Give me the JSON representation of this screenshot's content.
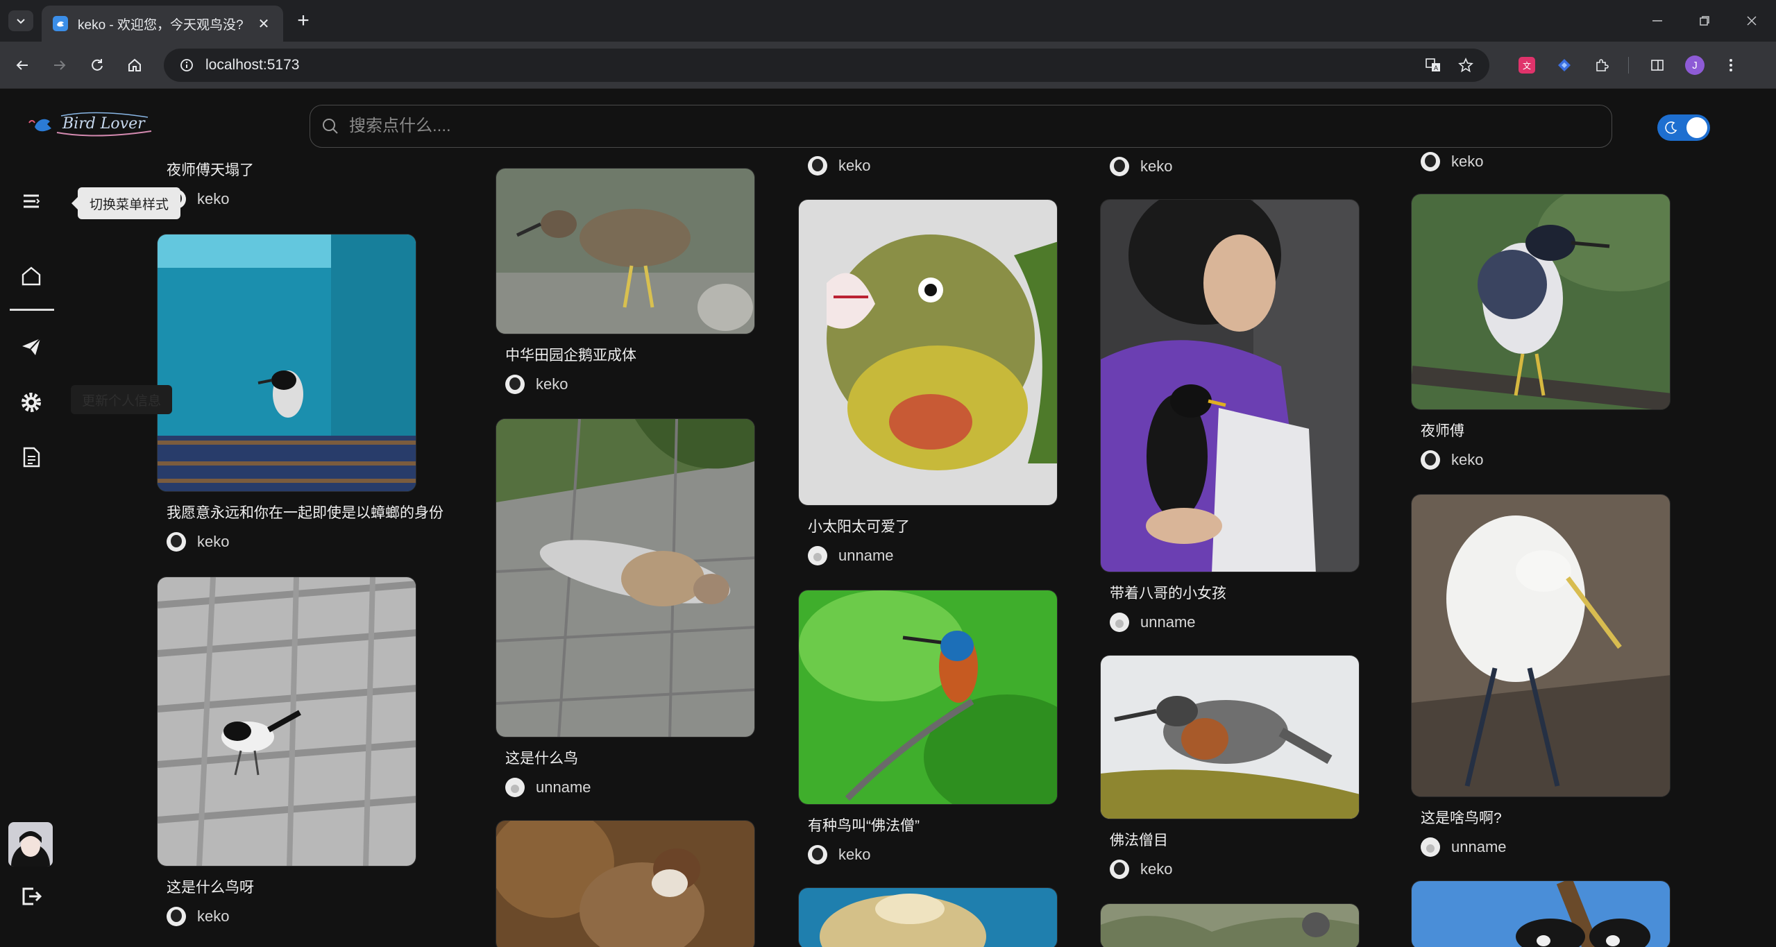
{
  "browser": {
    "tab_title": "keko - 欢迎您，今天观鸟没?",
    "url": "localhost:5173",
    "profile_initial": "J"
  },
  "app": {
    "logo_text": "Bird Lover",
    "search": {
      "placeholder": "搜索点什么...."
    },
    "theme_toggle": "dark"
  },
  "sidebar": {
    "tooltip_menu": "切换菜单样式",
    "tooltip_settings": "更新个人信息",
    "items": [
      "menu-toggle",
      "home",
      "publish",
      "settings",
      "document"
    ]
  },
  "feed": {
    "col1": [
      {
        "title": "夜师傅天塌了",
        "user": "keko"
      },
      {
        "title": "我愿意永远和你在一起即使是以蟑螂的身份",
        "user": "keko"
      },
      {
        "title": "这是什么鸟呀",
        "user": "keko"
      }
    ],
    "col2": [
      {
        "title": "中华田园企鹅亚成体",
        "user": "keko"
      },
      {
        "title": "这是什么鸟",
        "user": "unname"
      },
      {
        "title": "",
        "user": ""
      }
    ],
    "col3": [
      {
        "title": "",
        "user": "keko"
      },
      {
        "title": "小太阳太可爱了",
        "user": "unname"
      },
      {
        "title": "有种鸟叫“佛法僧”",
        "user": "keko"
      }
    ],
    "col4": [
      {
        "title": "",
        "user": "keko"
      },
      {
        "title": "带着八哥的小女孩",
        "user": "unname"
      },
      {
        "title": "佛法僧目",
        "user": "keko"
      }
    ],
    "col5": [
      {
        "title": "",
        "user": "keko"
      },
      {
        "title": "夜师傅",
        "user": "keko"
      },
      {
        "title": "这是啥鸟啊?",
        "user": "unname"
      }
    ]
  }
}
